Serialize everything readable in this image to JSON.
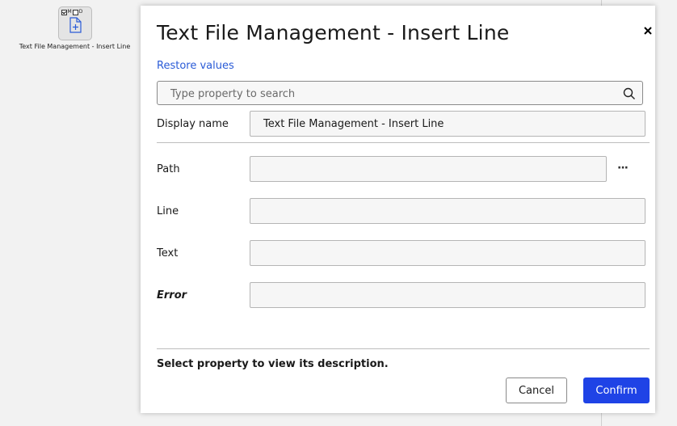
{
  "canvas": {
    "node": {
      "label": "Text File Management - Insert Line",
      "flag_m": "M",
      "flag_d": "D",
      "icon": "document-plus-icon"
    }
  },
  "dialog": {
    "title": "Text File Management - Insert Line",
    "restore_label": "Restore values",
    "search": {
      "placeholder": "Type property to search"
    },
    "display_name": {
      "label": "Display name",
      "value": "Text File Management - Insert Line"
    },
    "properties": {
      "path": {
        "label": "Path",
        "value": ""
      },
      "line": {
        "label": "Line",
        "value": ""
      },
      "text": {
        "label": "Text",
        "value": ""
      },
      "error": {
        "label": "Error",
        "value": ""
      }
    },
    "browse_label": "···",
    "description": "Select property to view its description.",
    "cancel_label": "Cancel",
    "confirm_label": "Confirm"
  },
  "colors": {
    "accent": "#1f43e6",
    "link": "#2a5bd7",
    "background": "#f2f2f2"
  }
}
